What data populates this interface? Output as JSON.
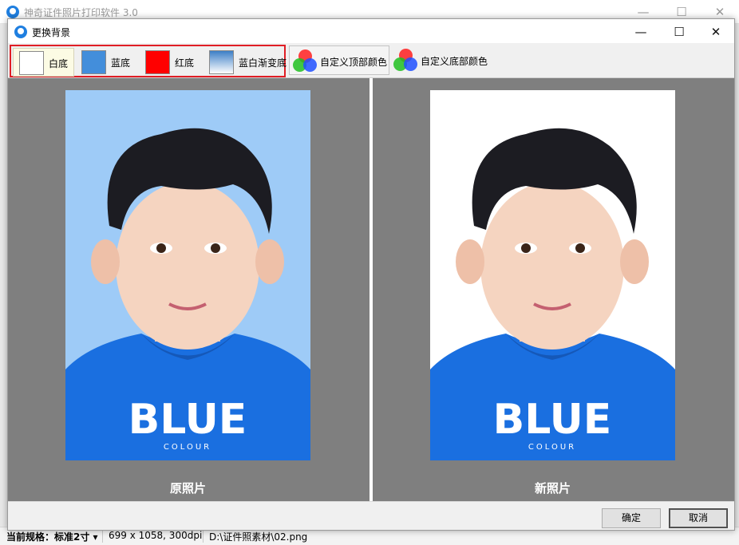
{
  "app": {
    "title": "神奇证件照片打印软件 3.0",
    "minimize": "—",
    "maximize": "☐",
    "close": "✕"
  },
  "dialog": {
    "title": "更换背景",
    "minimize": "—",
    "maximize": "☐",
    "close": "✕"
  },
  "toolbar": {
    "presets": [
      {
        "label": "白底",
        "color": "#ffffff",
        "selected": true
      },
      {
        "label": "蓝底",
        "color": "#438edb",
        "selected": false
      },
      {
        "label": "红底",
        "color": "#ff0000",
        "selected": false
      },
      {
        "label": "蓝白渐变底",
        "color_top": "#3d7fc7",
        "color_bottom": "#ffffff",
        "selected": false
      }
    ],
    "custom_top": "自定义顶部颜色",
    "custom_bottom": "自定义底部颜色"
  },
  "preview": {
    "original_caption": "原照片",
    "new_caption": "新照片",
    "original_bg": "#9ecbf7",
    "new_bg": "#ffffff",
    "shirt_text": "BLUE",
    "shirt_subtext": "COLOUR",
    "shirt_color": "#1a6fe0"
  },
  "buttons": {
    "confirm": "确定",
    "cancel": "取消"
  },
  "statusbar": {
    "spec": "当前规格：标准2寸 ▾",
    "size": "699 x 1058, 300dpi",
    "path": "D:\\证件照素材\\02.png"
  },
  "colors": {
    "accent_red": "#e01e25",
    "workspace": "#7f7f7f"
  }
}
